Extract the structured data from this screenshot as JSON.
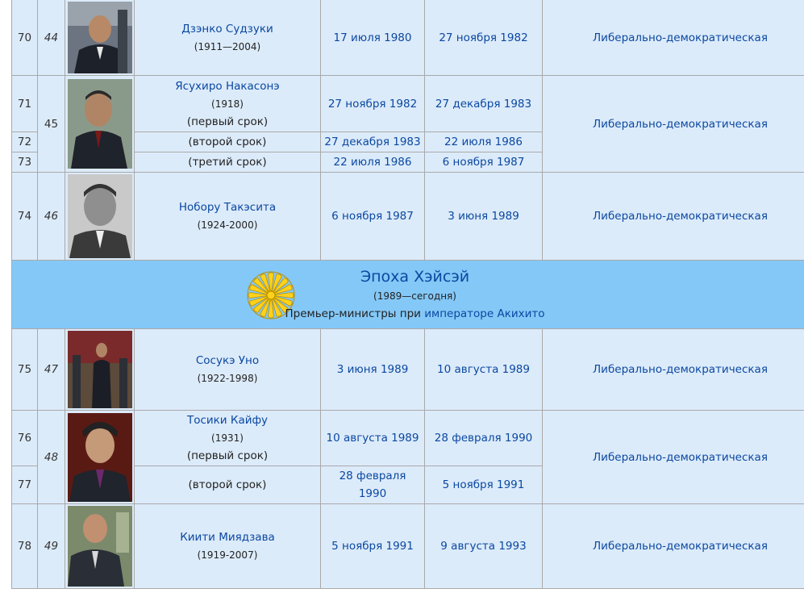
{
  "rows": [
    {
      "num": "70",
      "ord": "44",
      "name": "Дзэнко Судзуки",
      "years": "(1911—2004)",
      "start": "17 июля 1980",
      "end": "27 ноября 1982",
      "party": "Либерально-демократическая",
      "photo": "portrait-suzuki"
    },
    {
      "num": "71",
      "ord": "45",
      "name": "Ясухиро Накасонэ",
      "years": "(1918)",
      "term": "(первый срок)",
      "start": "27 ноября 1982",
      "end": "27 декабря 1983",
      "party": "Либерально-демократическая",
      "photo": "portrait-nakasone"
    },
    {
      "num": "72",
      "term": "(второй срок)",
      "start": "27 декабря 1983",
      "end": "22 июля 1986"
    },
    {
      "num": "73",
      "term": "(третий срок)",
      "start": "22 июля 1986",
      "end": "6 ноября 1987"
    },
    {
      "num": "74",
      "ord": "46",
      "name": "Нобору Такэсита",
      "years": "(1924-2000)",
      "start": "6 ноября 1987",
      "end": "3 июня 1989",
      "party": "Либерально-демократическая",
      "photo": "portrait-takeshita"
    },
    {
      "num": "75",
      "ord": "47",
      "name": "Сосукэ Уно",
      "years": "(1922-1998)",
      "start": "3 июня 1989",
      "end": "10 августа 1989",
      "party": "Либерально-демократическая",
      "photo": "portrait-uno"
    },
    {
      "num": "76",
      "ord": "48",
      "name": "Тосики Кайфу",
      "years": "(1931)",
      "term": "(первый срок)",
      "start": "10 августа 1989",
      "end": "28 февраля 1990",
      "party": "Либерально-демократическая",
      "photo": "portrait-kaifu"
    },
    {
      "num": "77",
      "term": "(второй срок)",
      "start": "28 февраля 1990",
      "end": "5 ноября 1991"
    },
    {
      "num": "78",
      "ord": "49",
      "name": "Киити Миядзава",
      "years": "(1919-2007)",
      "start": "5 ноября 1991",
      "end": "9 августа 1993",
      "party": "Либерально-демократическая",
      "photo": "portrait-miyazawa"
    }
  ],
  "era": {
    "title": "Эпоха Хэйсэй",
    "period": "(1989—сегодня)",
    "subtitle_prefix": "Премьер-министры при ",
    "subtitle_link": "императоре Акихито",
    "emblem": "chrysanthemum-seal-icon"
  },
  "colors": {
    "cell_bg": "#dcebfa",
    "era_bg": "#84c8f7",
    "link": "#0b48a1",
    "border": "#a9a9a9",
    "seal": "#ffd21a"
  }
}
